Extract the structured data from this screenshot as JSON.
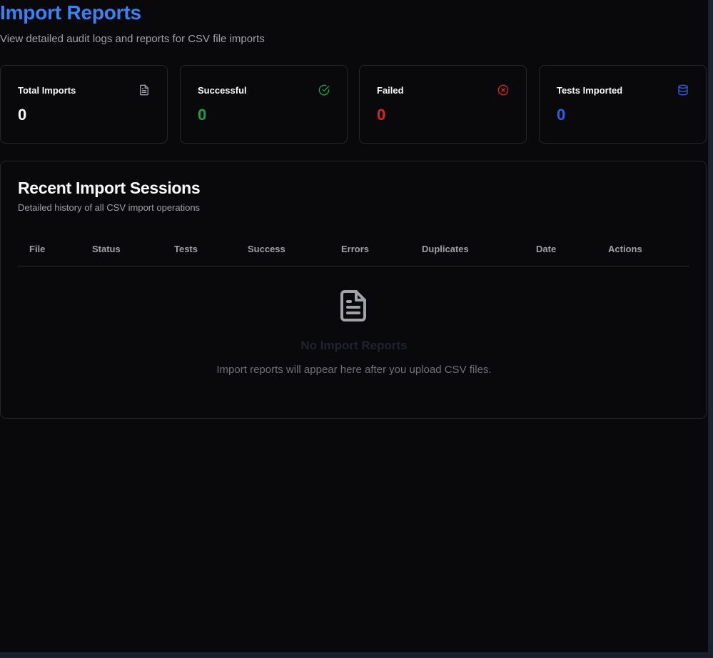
{
  "header": {
    "title": "Import Reports",
    "subtitle": "View detailed audit logs and reports for CSV file imports"
  },
  "stats": [
    {
      "label": "Total Imports",
      "value": "0",
      "icon": "file-text-icon",
      "color": "#fafafa"
    },
    {
      "label": "Successful",
      "value": "0",
      "icon": "check-circle-icon",
      "color": "#16a34a"
    },
    {
      "label": "Failed",
      "value": "0",
      "icon": "x-circle-icon",
      "color": "#dc2626"
    },
    {
      "label": "Tests Imported",
      "value": "0",
      "icon": "database-icon",
      "color": "#2563eb"
    }
  ],
  "sessions": {
    "title": "Recent Import Sessions",
    "description": "Detailed history of all CSV import operations",
    "columns": [
      "File",
      "Status",
      "Tests",
      "Success",
      "Errors",
      "Duplicates",
      "Date",
      "Actions"
    ],
    "empty": {
      "icon": "file-text-icon",
      "title": "No Import Reports",
      "message": "Import reports will appear here after you upload CSV files."
    }
  },
  "colors": {
    "accent": "#3b82f6",
    "background": "#09090b",
    "border": "#27272a",
    "success": "#16a34a",
    "danger": "#dc2626",
    "info": "#2563eb"
  }
}
